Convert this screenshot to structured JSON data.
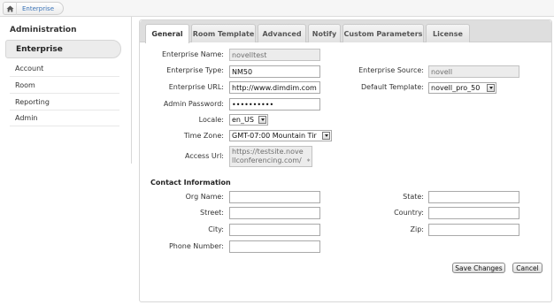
{
  "breadcrumb": {
    "home_icon": "home-icon",
    "item": "Enterprise"
  },
  "sidebar": {
    "title": "Administration",
    "active": "Enterprise",
    "items": [
      "Account",
      "Room",
      "Reporting",
      "Admin"
    ]
  },
  "tabs": [
    "General",
    "Room Template",
    "Advanced",
    "Notify",
    "Custom Parameters",
    "License"
  ],
  "active_tab": "General",
  "form": {
    "enterprise_name_label": "Enterprise Name:",
    "enterprise_name_value": "novelltest",
    "enterprise_type_label": "Enterprise Type:",
    "enterprise_type_value": "NM50",
    "enterprise_url_label": "Enterprise URL:",
    "enterprise_url_value": "http://www.dimdim.com",
    "admin_password_label": "Admin Password:",
    "admin_password_value": "••••••••••",
    "locale_label": "Locale:",
    "locale_value": "en_US",
    "time_zone_label": "Time Zone:",
    "time_zone_value": "GMT-07:00 Mountain Tir",
    "access_url_label": "Access Url:",
    "access_url_line1": "https://testsite.nove",
    "access_url_line2": "llconferencing.com/",
    "enterprise_source_label": "Enterprise Source:",
    "enterprise_source_value": "novell",
    "default_template_label": "Default Template:",
    "default_template_value": "novell_pro_50"
  },
  "contact": {
    "title": "Contact Information",
    "org_name_label": "Org Name:",
    "street_label": "Street:",
    "city_label": "City:",
    "phone_label": "Phone Number:",
    "state_label": "State:",
    "country_label": "Country:",
    "zip_label": "Zip:"
  },
  "buttons": {
    "save": "Save Changes",
    "cancel": "Cancel"
  }
}
